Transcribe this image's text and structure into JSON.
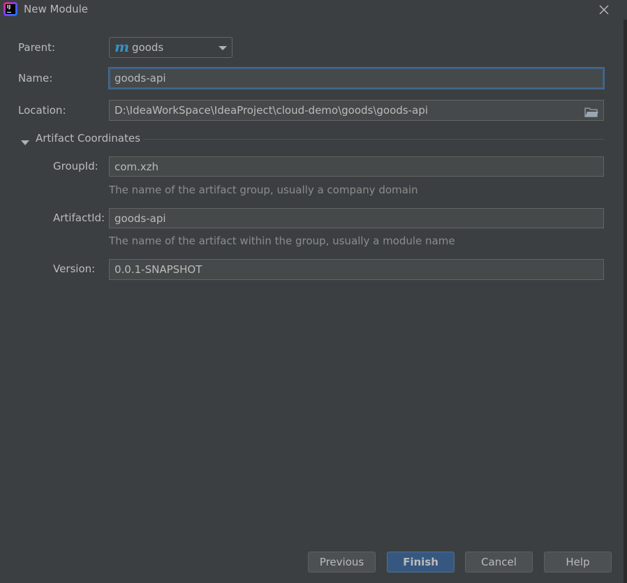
{
  "window": {
    "title": "New Module",
    "logo_icon": "intellij-idea-icon",
    "close_icon": "close-icon"
  },
  "form": {
    "parent_label": "Parent:",
    "parent_value": "goods",
    "parent_icon": "maven-module-icon",
    "name_label": "Name:",
    "name_value": "goods-api",
    "location_label": "Location:",
    "location_value": "D:\\IdeaWorkSpace\\IdeaProject\\cloud-demo\\goods\\goods-api",
    "browse_icon": "folder-icon"
  },
  "artifact": {
    "section_title": "Artifact Coordinates",
    "expanded": true,
    "group_label": "GroupId:",
    "group_value": "com.xzh",
    "group_hint": "The name of the artifact group, usually a company domain",
    "artifact_label": "ArtifactId:",
    "artifact_value": "goods-api",
    "artifact_hint": "The name of the artifact within the group, usually a module name",
    "version_label": "Version:",
    "version_value": "0.0.1-SNAPSHOT"
  },
  "buttons": {
    "previous": "Previous",
    "finish": "Finish",
    "cancel": "Cancel",
    "help": "Help"
  },
  "colors": {
    "background": "#3c3f41",
    "field_bg": "#45494a",
    "primary_button": "#365880",
    "focus_border": "#3d6185",
    "maven_icon": "#3592c4"
  }
}
